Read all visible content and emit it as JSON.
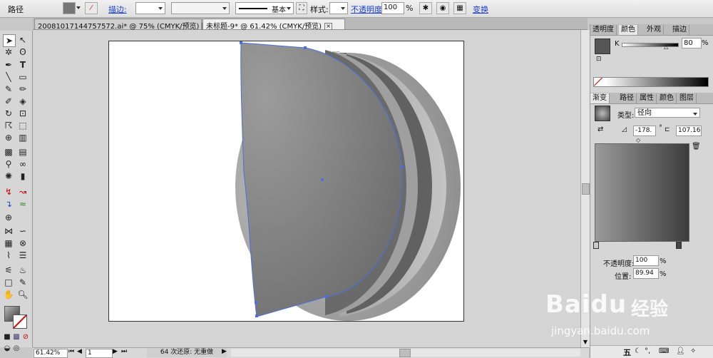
{
  "control_bar": {
    "object_type": "路径",
    "stroke_label": "描边:",
    "brush_label": "基本",
    "style_label": "样式:",
    "opacity_label": "不透明度:",
    "opacity_value": "100",
    "opacity_unit": "%",
    "transform_label": "变换"
  },
  "doc_tabs": [
    {
      "title": "20081017144757572.ai* @ 75% (CMYK/预览)",
      "active": false
    },
    {
      "title": "未标题-9* @ 61.42% (CMYK/预览)",
      "active": true
    }
  ],
  "status_bar": {
    "zoom": "61.42%",
    "artboard": "1",
    "undo_status": "64 次还原: 无重做"
  },
  "color_panel": {
    "tabs": [
      "透明度",
      "颜色",
      "外观",
      "描边"
    ],
    "active_tab": "颜色",
    "channel": "K",
    "k_value": "80"
  },
  "gradient_panel": {
    "tabs": [
      "渐变",
      "路径",
      "属性",
      "颜色",
      "图层"
    ],
    "active_tab": "渐变",
    "type_label": "类型:",
    "type_value": "径向",
    "angle_value": "-178.",
    "angle_unit": "°",
    "aspect_value": "107.16",
    "aspect_unit": "%",
    "opacity_label": "不透明度:",
    "opacity_value": "100",
    "opacity_unit": "%",
    "location_label": "位置:",
    "location_value": "89.94",
    "location_unit": "%"
  },
  "watermark": {
    "brand": "Baidu",
    "brand_cn": "经验",
    "url": "jingyan.baidu.com"
  },
  "taskbar": {
    "ime": "五"
  },
  "colors": {
    "path_selection": "#4a6fe0",
    "gray_shape": "#8a8a8a",
    "dark_band": "#5e5e5e"
  }
}
